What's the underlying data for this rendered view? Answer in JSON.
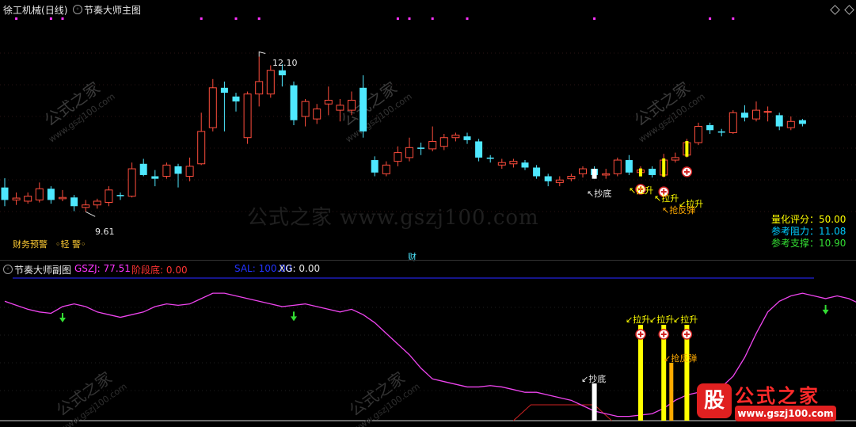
{
  "header": {
    "stock": "徐工机械",
    "period": "(日线)",
    "main_indicator": "节奏大师主图",
    "sub_indicator": "节奏大师副图"
  },
  "colors": {
    "up": "#ff4d3d",
    "down": "#4ee8ff",
    "pink": "#ff33ff",
    "yellow": "#ffff00",
    "orange": "#ffaa00",
    "cyan": "#00e5ff",
    "green": "#33dd33"
  },
  "main_panel": {
    "high_label": "12.10",
    "low_label": "9.61",
    "warning_label": "财务预警",
    "warning_value": "轻 警",
    "fin_marker": "财",
    "signal_chaodi": "抄底",
    "signal_lasheng": "拉升",
    "signal_qiangfantan": "抢反弹",
    "score_label": "量化评分：",
    "score_value": "50.00",
    "resistance_label": "参考阻力：",
    "resistance_value": "11.08",
    "support_label": "参考支撑：",
    "support_value": "10.90",
    "watermark_center": "公式之家 www.gszj100.com"
  },
  "sub_panel": {
    "gszj_label": "GSZJ:",
    "gszj_value": "77.51",
    "stage_label": "阶段底:",
    "stage_value": "0.00",
    "sal_label": "SAL:",
    "sal_value": "100.00",
    "xg_label": "XG:",
    "xg_value": "0.00",
    "signal_chaodi": "抄底",
    "signal_lasheng": "拉升",
    "signal_qiangfantan": "抢反弹"
  },
  "watermarks": {
    "cn": "公式之家",
    "url": "www.gszj100.com"
  },
  "logo": {
    "text": "公式之家",
    "url": "www.gszj100.com",
    "glyph": "股"
  },
  "chart_data": {
    "type": "candlestick",
    "y_unit": "price",
    "candles": [
      {
        "o": 10.0,
        "c": 9.8,
        "h": 10.15,
        "l": 9.7
      },
      {
        "o": 9.8,
        "c": 9.83,
        "h": 9.92,
        "l": 9.72
      },
      {
        "o": 9.78,
        "c": 9.86,
        "h": 9.92,
        "l": 9.74
      },
      {
        "o": 9.8,
        "c": 9.98,
        "h": 10.08,
        "l": 9.76
      },
      {
        "o": 9.98,
        "c": 9.8,
        "h": 10.02,
        "l": 9.74
      },
      {
        "o": 9.82,
        "c": 9.84,
        "h": 9.96,
        "l": 9.78
      },
      {
        "o": 9.84,
        "c": 9.7,
        "h": 9.88,
        "l": 9.62
      },
      {
        "o": 9.68,
        "c": 9.72,
        "h": 9.8,
        "l": 9.61
      },
      {
        "o": 9.72,
        "c": 9.78,
        "h": 9.82,
        "l": 9.66
      },
      {
        "o": 9.76,
        "c": 9.96,
        "h": 10.02,
        "l": 9.7
      },
      {
        "o": 9.88,
        "c": 9.86,
        "h": 9.92,
        "l": 9.8
      },
      {
        "o": 9.86,
        "c": 10.3,
        "h": 10.4,
        "l": 9.84
      },
      {
        "o": 10.38,
        "c": 10.2,
        "h": 10.46,
        "l": 10.18
      },
      {
        "o": 10.18,
        "c": 10.14,
        "h": 10.28,
        "l": 10.02
      },
      {
        "o": 10.18,
        "c": 10.36,
        "h": 10.4,
        "l": 10.14
      },
      {
        "o": 10.34,
        "c": 10.22,
        "h": 10.38,
        "l": 10.0
      },
      {
        "o": 10.18,
        "c": 10.34,
        "h": 10.48,
        "l": 10.1
      },
      {
        "o": 10.38,
        "c": 10.9,
        "h": 11.2,
        "l": 10.36
      },
      {
        "o": 10.96,
        "c": 11.6,
        "h": 11.74,
        "l": 10.9
      },
      {
        "o": 11.6,
        "c": 11.52,
        "h": 11.7,
        "l": 10.9
      },
      {
        "o": 11.46,
        "c": 11.38,
        "h": 11.52,
        "l": 11.22
      },
      {
        "o": 10.8,
        "c": 11.5,
        "h": 11.54,
        "l": 10.7
      },
      {
        "o": 11.5,
        "c": 11.7,
        "h": 12.1,
        "l": 11.3
      },
      {
        "o": 11.5,
        "c": 11.88,
        "h": 11.96,
        "l": 11.44
      },
      {
        "o": 11.88,
        "c": 11.8,
        "h": 11.98,
        "l": 11.62
      },
      {
        "o": 11.64,
        "c": 11.08,
        "h": 11.7,
        "l": 11.0
      },
      {
        "o": 11.14,
        "c": 11.38,
        "h": 11.42,
        "l": 10.98
      },
      {
        "o": 11.1,
        "c": 11.26,
        "h": 11.34,
        "l": 11.02
      },
      {
        "o": 11.34,
        "c": 11.4,
        "h": 11.62,
        "l": 11.16
      },
      {
        "o": 11.24,
        "c": 11.32,
        "h": 11.42,
        "l": 11.06
      },
      {
        "o": 11.24,
        "c": 11.4,
        "h": 11.54,
        "l": 11.16
      },
      {
        "o": 11.6,
        "c": 10.9,
        "h": 11.8,
        "l": 10.8
      },
      {
        "o": 10.44,
        "c": 10.24,
        "h": 10.5,
        "l": 10.18
      },
      {
        "o": 10.22,
        "c": 10.36,
        "h": 10.42,
        "l": 10.18
      },
      {
        "o": 10.42,
        "c": 10.56,
        "h": 10.66,
        "l": 10.34
      },
      {
        "o": 10.48,
        "c": 10.64,
        "h": 10.8,
        "l": 10.42
      },
      {
        "o": 10.64,
        "c": 10.62,
        "h": 10.72,
        "l": 10.52
      },
      {
        "o": 10.62,
        "c": 10.74,
        "h": 10.98,
        "l": 10.58
      },
      {
        "o": 10.66,
        "c": 10.8,
        "h": 10.86,
        "l": 10.6
      },
      {
        "o": 10.8,
        "c": 10.84,
        "h": 10.88,
        "l": 10.74
      },
      {
        "o": 10.82,
        "c": 10.76,
        "h": 10.88,
        "l": 10.7
      },
      {
        "o": 10.74,
        "c": 10.48,
        "h": 10.78,
        "l": 10.42
      },
      {
        "o": 10.48,
        "c": 10.46,
        "h": 10.52,
        "l": 10.4
      },
      {
        "o": 10.36,
        "c": 10.4,
        "h": 10.46,
        "l": 10.3
      },
      {
        "o": 10.38,
        "c": 10.42,
        "h": 10.46,
        "l": 10.32
      },
      {
        "o": 10.4,
        "c": 10.32,
        "h": 10.44,
        "l": 10.28
      },
      {
        "o": 10.32,
        "c": 10.18,
        "h": 10.36,
        "l": 10.14
      },
      {
        "o": 10.18,
        "c": 10.1,
        "h": 10.22,
        "l": 10.02
      },
      {
        "o": 10.08,
        "c": 10.12,
        "h": 10.18,
        "l": 10.02
      },
      {
        "o": 10.14,
        "c": 10.18,
        "h": 10.22,
        "l": 10.1
      },
      {
        "o": 10.22,
        "c": 10.3,
        "h": 10.34,
        "l": 10.16
      },
      {
        "o": 10.3,
        "c": 10.2,
        "h": 10.34,
        "l": 10.14
      },
      {
        "o": 10.2,
        "c": 10.22,
        "h": 10.3,
        "l": 10.14
      },
      {
        "o": 10.22,
        "c": 10.44,
        "h": 10.48,
        "l": 10.18
      },
      {
        "o": 10.44,
        "c": 10.24,
        "h": 10.52,
        "l": 10.2
      },
      {
        "o": 10.24,
        "c": 10.28,
        "h": 10.34,
        "l": 10.2
      },
      {
        "o": 10.3,
        "c": 10.2,
        "h": 10.34,
        "l": 10.16
      },
      {
        "o": 10.2,
        "c": 10.44,
        "h": 10.54,
        "l": 10.16
      },
      {
        "o": 10.44,
        "c": 10.48,
        "h": 10.56,
        "l": 10.4
      },
      {
        "o": 10.52,
        "c": 10.72,
        "h": 10.78,
        "l": 10.48
      },
      {
        "o": 10.72,
        "c": 10.98,
        "h": 11.04,
        "l": 10.68
      },
      {
        "o": 11.0,
        "c": 10.92,
        "h": 11.04,
        "l": 10.86
      },
      {
        "o": 10.9,
        "c": 10.88,
        "h": 10.94,
        "l": 10.82
      },
      {
        "o": 10.88,
        "c": 11.2,
        "h": 11.24,
        "l": 10.86
      },
      {
        "o": 11.2,
        "c": 11.12,
        "h": 11.32,
        "l": 11.06
      },
      {
        "o": 11.1,
        "c": 11.24,
        "h": 11.38,
        "l": 11.06
      },
      {
        "o": 11.22,
        "c": 11.22,
        "h": 11.3,
        "l": 11.06
      },
      {
        "o": 11.16,
        "c": 10.98,
        "h": 11.2,
        "l": 10.92
      },
      {
        "o": 10.96,
        "c": 11.06,
        "h": 11.14,
        "l": 10.92
      },
      {
        "o": 11.08,
        "c": 11.02,
        "h": 11.1,
        "l": 10.98
      }
    ],
    "high": 12.1,
    "low": 9.61,
    "ylim": [
      9.5,
      12.5
    ],
    "sub_line_ylim": [
      0,
      100
    ],
    "sub_line": [
      88,
      85,
      82,
      80,
      79,
      84,
      86,
      84,
      80,
      78,
      76,
      78,
      80,
      84,
      86,
      85,
      86,
      90,
      94,
      94,
      92,
      90,
      88,
      86,
      84,
      85,
      86,
      84,
      82,
      80,
      82,
      78,
      72,
      64,
      56,
      48,
      38,
      30,
      28,
      26,
      24,
      24,
      25,
      24,
      22,
      20,
      20,
      18,
      16,
      14,
      10,
      6,
      4,
      2,
      2,
      3,
      4,
      8,
      14,
      18,
      20,
      24,
      24,
      32,
      46,
      64,
      80,
      88,
      92,
      94,
      92,
      90,
      92,
      90,
      86,
      82
    ],
    "signals": {
      "pink_markers": [
        1,
        4,
        5,
        17,
        20,
        22,
        34,
        35,
        37,
        40,
        51,
        61,
        63
      ],
      "green_arrows": [
        5,
        25,
        71
      ],
      "chaodi_bar": 51,
      "lasheng_bars": [
        55,
        57,
        59
      ],
      "qiangfantan_bar": 58,
      "plus_markers": [
        55,
        57,
        59
      ]
    }
  }
}
